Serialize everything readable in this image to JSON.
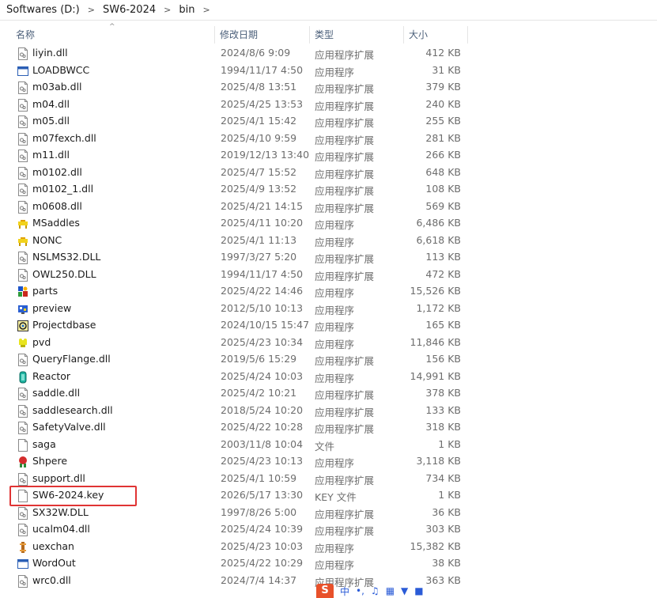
{
  "breadcrumb": [
    "Softwares (D:)",
    "SW6-2024",
    "bin"
  ],
  "breadcrumb_sep": ">",
  "columns": {
    "name": "名称",
    "date": "修改日期",
    "type": "类型",
    "size": "大小"
  },
  "sort_indicator": "^",
  "files": [
    {
      "name": "liyin.dll",
      "date": "2024/8/6 9:09",
      "type": "应用程序扩展",
      "size": "412 KB",
      "icon": "dll-icon"
    },
    {
      "name": "LOADBWCC",
      "date": "1994/11/17 4:50",
      "type": "应用程序",
      "size": "31 KB",
      "icon": "exe-window-icon"
    },
    {
      "name": "m03ab.dll",
      "date": "2025/4/8 13:51",
      "type": "应用程序扩展",
      "size": "379 KB",
      "icon": "dll-icon"
    },
    {
      "name": "m04.dll",
      "date": "2025/4/25 13:53",
      "type": "应用程序扩展",
      "size": "240 KB",
      "icon": "dll-icon"
    },
    {
      "name": "m05.dll",
      "date": "2025/4/1 15:42",
      "type": "应用程序扩展",
      "size": "255 KB",
      "icon": "dll-icon"
    },
    {
      "name": "m07fexch.dll",
      "date": "2025/4/10 9:59",
      "type": "应用程序扩展",
      "size": "281 KB",
      "icon": "dll-icon"
    },
    {
      "name": "m11.dll",
      "date": "2019/12/13 13:40",
      "type": "应用程序扩展",
      "size": "266 KB",
      "icon": "dll-icon"
    },
    {
      "name": "m0102.dll",
      "date": "2025/4/7 15:52",
      "type": "应用程序扩展",
      "size": "648 KB",
      "icon": "dll-icon"
    },
    {
      "name": "m0102_1.dll",
      "date": "2025/4/9 13:52",
      "type": "应用程序扩展",
      "size": "108 KB",
      "icon": "dll-icon"
    },
    {
      "name": "m0608.dll",
      "date": "2025/4/21 14:15",
      "type": "应用程序扩展",
      "size": "569 KB",
      "icon": "dll-icon"
    },
    {
      "name": "MSaddles",
      "date": "2025/4/11 10:20",
      "type": "应用程序",
      "size": "6,486 KB",
      "icon": "saddle-app-icon"
    },
    {
      "name": "NONC",
      "date": "2025/4/1 11:13",
      "type": "应用程序",
      "size": "6,618 KB",
      "icon": "saddle-app-icon"
    },
    {
      "name": "NSLMS32.DLL",
      "date": "1997/3/27 5:20",
      "type": "应用程序扩展",
      "size": "113 KB",
      "icon": "dll-icon"
    },
    {
      "name": "OWL250.DLL",
      "date": "1994/11/17 4:50",
      "type": "应用程序扩展",
      "size": "472 KB",
      "icon": "dll-icon"
    },
    {
      "name": "parts",
      "date": "2025/4/22 14:46",
      "type": "应用程序",
      "size": "15,526 KB",
      "icon": "parts-app-icon"
    },
    {
      "name": "preview",
      "date": "2012/5/10 10:13",
      "type": "应用程序",
      "size": "1,172 KB",
      "icon": "preview-app-icon"
    },
    {
      "name": "Projectdbase",
      "date": "2024/10/15 15:47",
      "type": "应用程序",
      "size": "165 KB",
      "icon": "database-app-icon"
    },
    {
      "name": "pvd",
      "date": "2025/4/23 10:34",
      "type": "应用程序",
      "size": "11,846 KB",
      "icon": "pvd-app-icon"
    },
    {
      "name": "QueryFlange.dll",
      "date": "2019/5/6 15:29",
      "type": "应用程序扩展",
      "size": "156 KB",
      "icon": "dll-icon"
    },
    {
      "name": "Reactor",
      "date": "2025/4/24 10:03",
      "type": "应用程序",
      "size": "14,991 KB",
      "icon": "reactor-app-icon"
    },
    {
      "name": "saddle.dll",
      "date": "2025/4/2 10:21",
      "type": "应用程序扩展",
      "size": "378 KB",
      "icon": "dll-icon"
    },
    {
      "name": "saddlesearch.dll",
      "date": "2018/5/24 10:20",
      "type": "应用程序扩展",
      "size": "133 KB",
      "icon": "dll-icon"
    },
    {
      "name": "SafetyValve.dll",
      "date": "2025/4/22 10:28",
      "type": "应用程序扩展",
      "size": "318 KB",
      "icon": "dll-icon"
    },
    {
      "name": "saga",
      "date": "2003/11/8 10:04",
      "type": "文件",
      "size": "1 KB",
      "icon": "blank-file-icon"
    },
    {
      "name": "Shpere",
      "date": "2025/4/23 10:13",
      "type": "应用程序",
      "size": "3,118 KB",
      "icon": "sphere-app-icon"
    },
    {
      "name": "support.dll",
      "date": "2025/4/1 10:59",
      "type": "应用程序扩展",
      "size": "734 KB",
      "icon": "dll-icon"
    },
    {
      "name": "SW6-2024.key",
      "date": "2026/5/17 13:30",
      "type": "KEY 文件",
      "size": "1 KB",
      "icon": "blank-file-icon"
    },
    {
      "name": "SX32W.DLL",
      "date": "1997/8/26 5:00",
      "type": "应用程序扩展",
      "size": "36 KB",
      "icon": "dll-icon"
    },
    {
      "name": "ucalm04.dll",
      "date": "2025/4/24 10:39",
      "type": "应用程序扩展",
      "size": "303 KB",
      "icon": "dll-icon"
    },
    {
      "name": "uexchan",
      "date": "2025/4/23 10:03",
      "type": "应用程序",
      "size": "15,382 KB",
      "icon": "exchanger-app-icon"
    },
    {
      "name": "WordOut",
      "date": "2025/4/22 10:29",
      "type": "应用程序",
      "size": "38 KB",
      "icon": "exe-window-icon"
    },
    {
      "name": "wrc0.dll",
      "date": "2024/7/4 14:37",
      "type": "应用程序扩展",
      "size": "363 KB",
      "icon": "dll-icon"
    }
  ],
  "ime_toolbar": {
    "logo": "S",
    "mode": "中"
  },
  "colors": {
    "highlight": "#e03434",
    "header_text": "#4c607a",
    "secondary_text": "#6d6d6d",
    "ime_orange": "#e8512a"
  }
}
